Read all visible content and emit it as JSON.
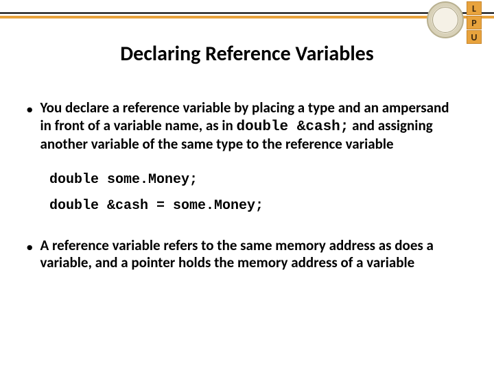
{
  "header": {
    "title": "Declaring Reference Variables",
    "badge_letters": [
      "L",
      "P",
      "U"
    ]
  },
  "bullets": [
    {
      "pre": "You declare a reference variable by placing a type and an ampersand in front of a variable name, as in ",
      "code": "double &cash;",
      "post": " and assigning another variable of the same type to the reference variable"
    },
    {
      "pre": "A reference variable refers to the same memory address as does a variable, and a pointer holds the memory address of a variable",
      "code": "",
      "post": ""
    }
  ],
  "code": {
    "line1": "double some.Money;",
    "line2": "double &cash = some.Money;"
  }
}
